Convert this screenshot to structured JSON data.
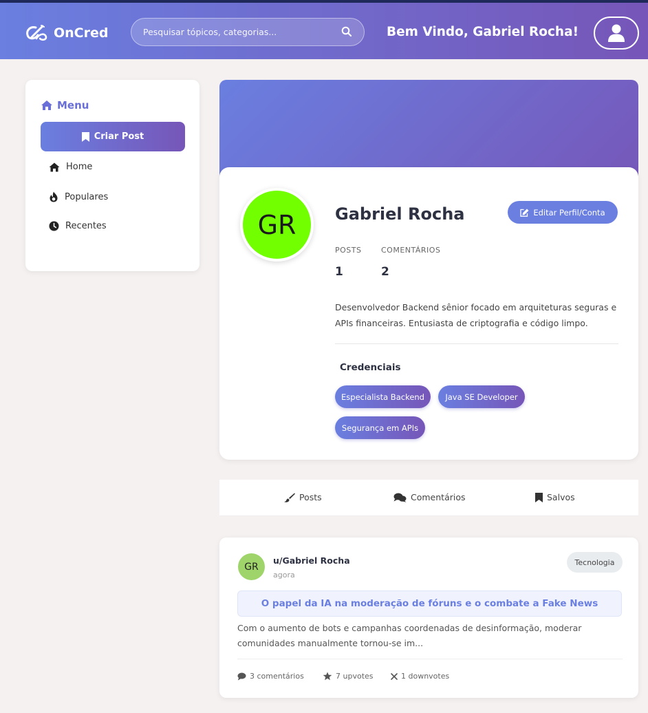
{
  "header": {
    "logo_text": "OnCred",
    "search_placeholder": "Pesquisar tópicos, categorias...",
    "welcome": "Bem Vindo, Gabriel Rocha!"
  },
  "menu": {
    "title": "Menu",
    "create_post": "Criar Post",
    "items": [
      {
        "label": "Home",
        "icon": "home-icon"
      },
      {
        "label": "Populares",
        "icon": "fire-icon"
      },
      {
        "label": "Recentes",
        "icon": "clock-icon"
      }
    ]
  },
  "profile": {
    "initials": "GR",
    "name": "Gabriel Rocha",
    "edit_label": "Editar Perfil/Conta",
    "avatar_color": "#72ff00",
    "stats": [
      {
        "label": "POSTS",
        "value": "1"
      },
      {
        "label": "COMENTÁRIOS",
        "value": "2"
      }
    ],
    "bio": "Desenvolvedor Backend sênior focado em arquiteturas seguras e APIs financeiras. Entusiasta de criptografia e código limpo.",
    "credentials_title": "Credenciais",
    "credentials": [
      "Especialista Backend",
      "Java SE Developer",
      "Segurança em APIs"
    ]
  },
  "tabs": [
    {
      "label": "Posts",
      "icon": "brush-icon"
    },
    {
      "label": "Comentários",
      "icon": "comments-icon"
    },
    {
      "label": "Salvos",
      "icon": "bookmark-icon"
    }
  ],
  "post": {
    "avatar_initials": "GR",
    "author": "u/Gabriel Rocha",
    "time": "agora",
    "tag": "Tecnologia",
    "title": "O papel da IA na moderação de fóruns e o combate a Fake News",
    "excerpt": "Com o aumento de bots e campanhas coordenadas de desinformação, moderar comunidades manualmente tornou-se im...",
    "comments": "3 comentários",
    "upvotes": "7 upvotes",
    "downvotes": "1 downvotes"
  },
  "colors": {
    "gradient_start": "#6a7fe0",
    "gradient_end": "#7656b8",
    "accent": "#6a7fe0",
    "background": "#f5f1f1"
  }
}
